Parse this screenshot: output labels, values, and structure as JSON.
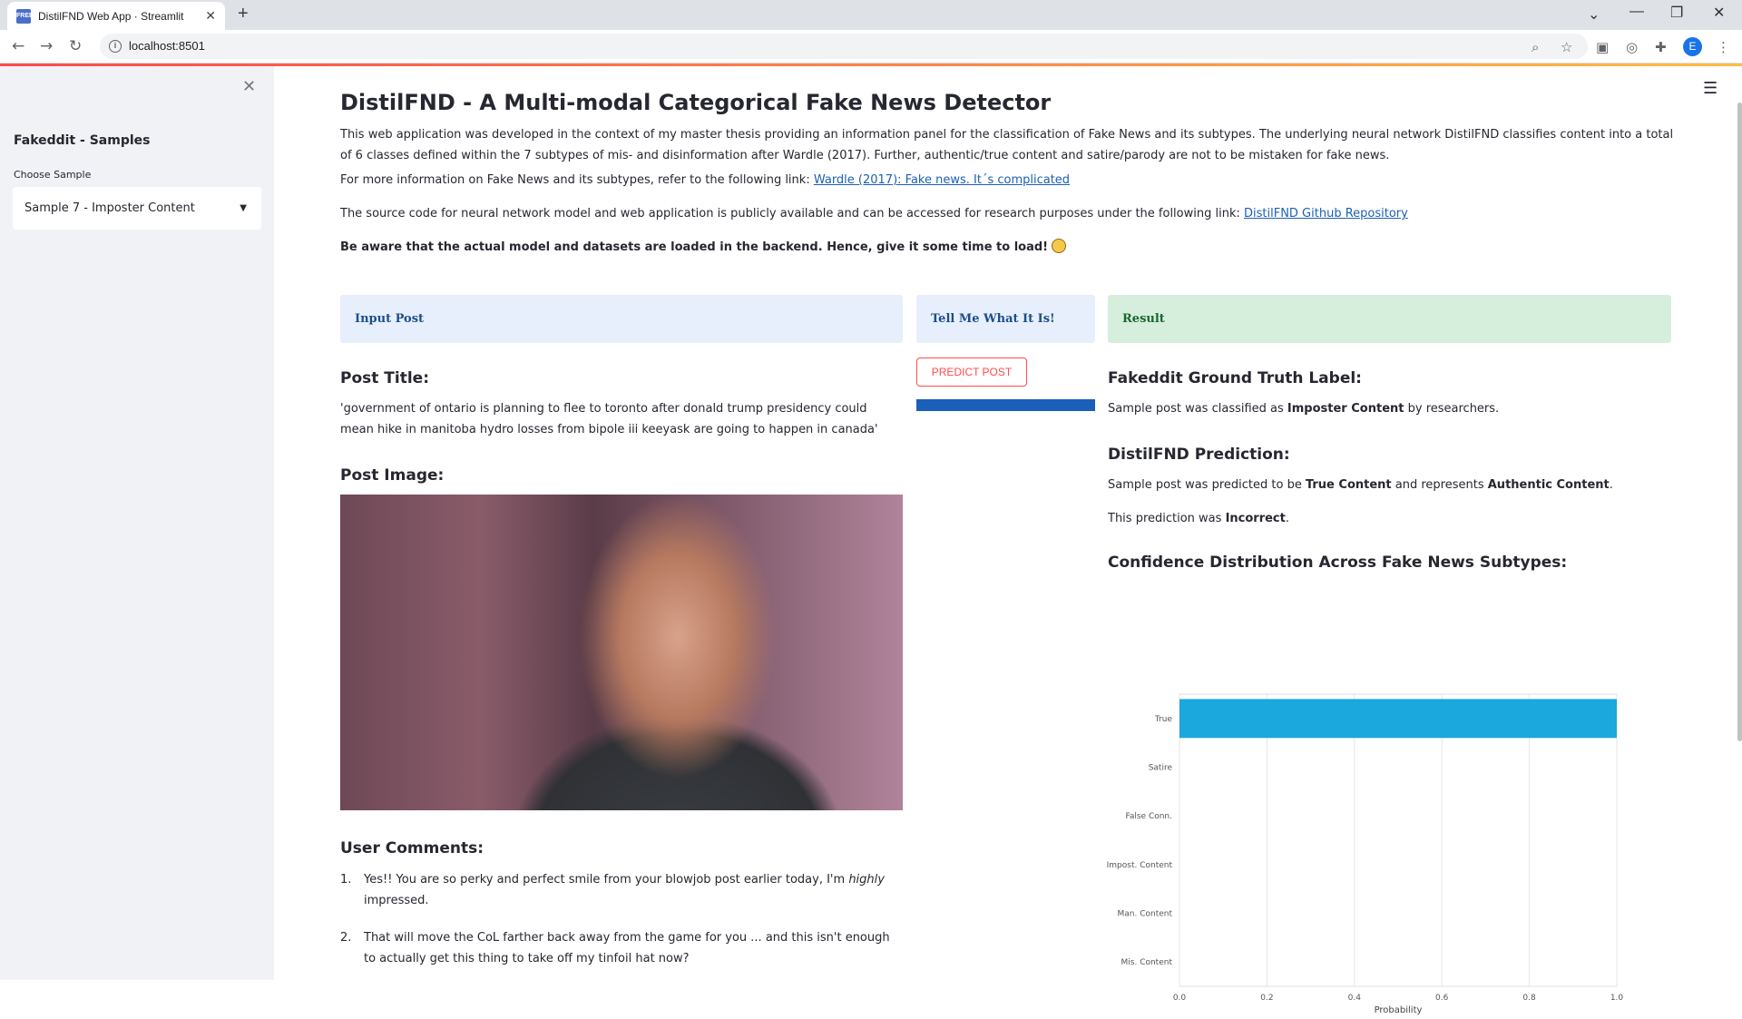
{
  "browser": {
    "tab_title": "DistilFND Web App · Streamlit",
    "favicon_label": "FREE",
    "url": "localhost:8501",
    "profile_initial": "E"
  },
  "sidebar": {
    "title": "Fakeddit - Samples",
    "select_label": "Choose Sample",
    "select_value": "Sample 7 - Imposter Content"
  },
  "main": {
    "title": "DistilFND - A Multi-modal Categorical Fake News Detector",
    "intro": "This web application was developed in the context of my master thesis providing an information panel for the classification of Fake News and its subtypes. The underlying neural network DistilFND classifies content into a total of 6 classes defined within the 7 subtypes of mis- and disinformation after Wardle (2017). Further, authentic/true content and satire/parody are not to be mistaken for fake news.",
    "more_info_text": "For more information on Fake News and its subtypes, refer to the following link: ",
    "more_info_link": "Wardle (2017): Fake news. It´s complicated",
    "source_text": "The source code for neural network model and web application is publicly available and can be accessed for research purposes under the following link: ",
    "source_link": "DistilFND Github Repository",
    "warning": "Be aware that the actual model and datasets are loaded in the backend. Hence, give it some time to load!",
    "panels": {
      "input": "Input Post",
      "tell": "Tell Me What It Is!",
      "result": "Result"
    },
    "post_title_heading": "Post Title:",
    "post_title": "'government of ontario is planning to flee to toronto after donald trump presidency could mean hike in manitoba hydro losses from bipole iii keeyask are going to happen in canada'",
    "post_image_heading": "Post Image:",
    "predict_button": "PREDICT POST",
    "progress": 1.0,
    "user_comments_heading": "User Comments:",
    "comments": [
      {
        "num": "1.",
        "pre": "Yes!! You are so perky and perfect smile from your blowjob post earlier today, I'm ",
        "em": "highly",
        "post": " impressed."
      },
      {
        "num": "2.",
        "pre": "That will move the CoL farther back away from the game for you ... and this isn't enough to actually get this thing to take off my tinfoil hat now?",
        "em": "",
        "post": ""
      }
    ],
    "ground_truth_heading": "Fakeddit Ground Truth Label:",
    "ground_truth_pre": "Sample post was classified as ",
    "ground_truth_label": "Imposter Content",
    "ground_truth_post": " by researchers.",
    "prediction_heading": "DistilFND Prediction:",
    "prediction_pre": "Sample post was predicted to be ",
    "prediction_label": "True Content",
    "prediction_mid": " and represents ",
    "prediction_category": "Authentic Content",
    "prediction_end": ".",
    "correctness_pre": "This prediction was ",
    "correctness_value": "Incorrect",
    "correctness_end": ".",
    "confidence_heading": "Confidence Distribution Across Fake News Subtypes:"
  },
  "chart_data": {
    "type": "bar",
    "orientation": "horizontal",
    "categories": [
      "True",
      "Satire",
      "False Conn.",
      "Impost. Content",
      "Man. Content",
      "Mis. Content"
    ],
    "values": [
      1.0,
      0.0,
      0.0,
      0.0,
      0.0,
      0.0
    ],
    "xlabel": "Probability",
    "ylabel": "",
    "xlim": [
      0,
      1
    ],
    "xticks": [
      "0.0",
      "0.2",
      "0.4",
      "0.6",
      "0.8",
      "1.0"
    ],
    "bar_color": "#1ba8dc",
    "grid": true
  }
}
